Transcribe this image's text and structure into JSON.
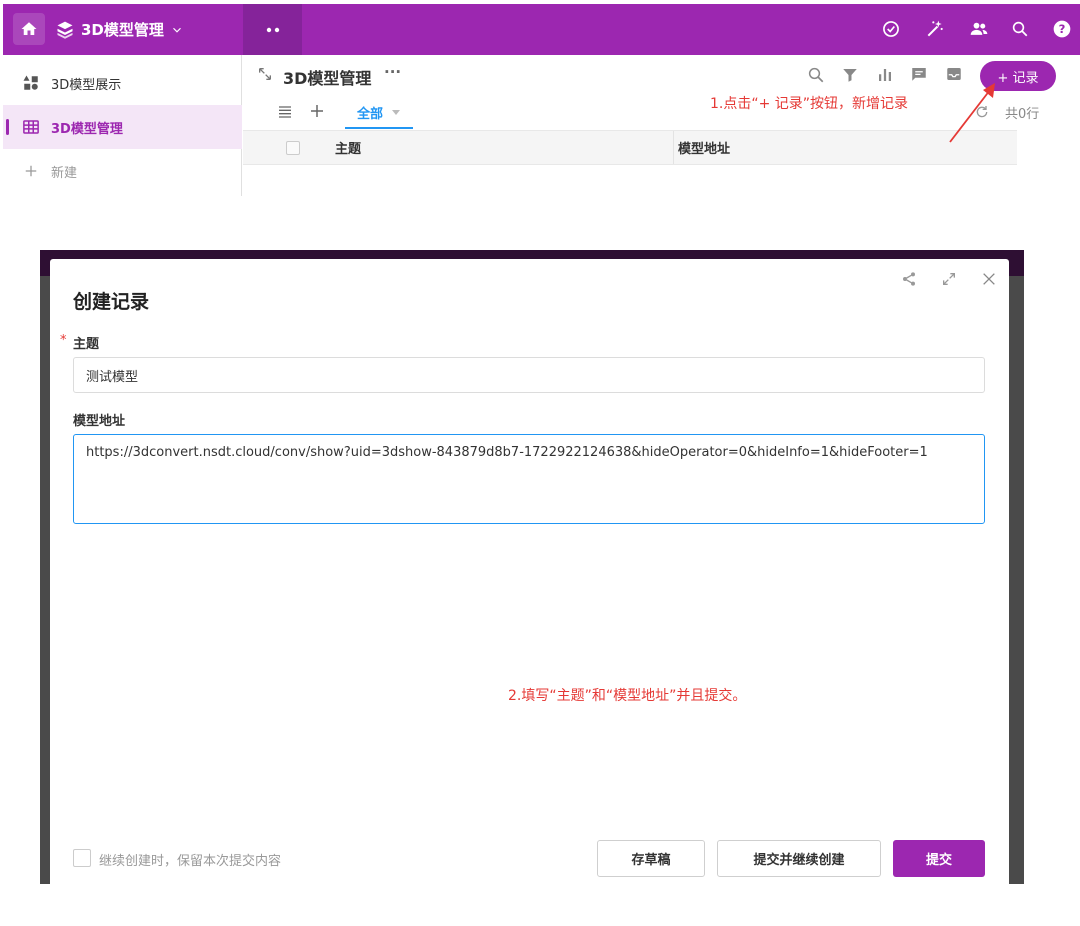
{
  "topbar": {
    "app_name": "3D模型管理",
    "accent": "#9c27b0",
    "icons": [
      "home-icon",
      "cube-stack-icon",
      "chevron-down-icon",
      "apps-dots-icon",
      "check-circle-icon",
      "magic-wand-icon",
      "users-icon",
      "search-icon",
      "help-icon"
    ]
  },
  "sidebar": {
    "items": [
      {
        "label": "3D模型展示",
        "icon": "widgets-icon"
      },
      {
        "label": "3D模型管理",
        "icon": "table-icon",
        "active": true
      },
      {
        "label": "新建",
        "icon": "plus-icon"
      }
    ]
  },
  "worksheet": {
    "title": "3D模型管理",
    "more": "···",
    "add_record_label": "+ 记录",
    "view_tab": "全部",
    "row_count": "共0行",
    "columns": [
      "主题",
      "模型地址"
    ],
    "toolbar_icons": [
      "search-icon",
      "filter-icon",
      "bar-chart-icon",
      "comment-icon",
      "inbox-icon",
      "refresh-icon",
      "list-icon",
      "add-view-icon",
      "expand-icon"
    ]
  },
  "annotations": {
    "step1": "1.点击“+ 记录”按钮，新增记录",
    "step2": "2.填写“主题”和“模型地址”并且提交。",
    "color": "#e53935"
  },
  "dialog": {
    "title": "创建记录",
    "required_mark": "*",
    "subject_label": "主题",
    "subject_value": "测试模型",
    "url_label": "模型地址",
    "url_value": "https://3dconvert.nsdt.cloud/conv/show?uid=3dshow-843879d8b7-1722922124638&hideOperator=0&hideInfo=1&hideFooter=1",
    "keep_label": "继续创建时，保留本次提交内容",
    "draft_label": "存草稿",
    "submit_continue_label": "提交并继续创建",
    "submit_label": "提交",
    "icons": [
      "share-icon",
      "fullscreen-icon",
      "close-icon"
    ]
  }
}
